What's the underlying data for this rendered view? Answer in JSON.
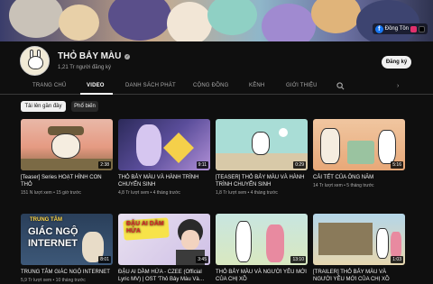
{
  "banner": {
    "link_label": "Đồng Tồn",
    "link_icon": "facebook-icon"
  },
  "channel": {
    "name": "THỎ BẢY MÀU",
    "verified_mark": "✓",
    "subscribers": "1,21 Tr người đăng ký",
    "subscribe_label": "Đăng ký"
  },
  "tabs": [
    {
      "label": "TRANG CHỦ"
    },
    {
      "label": "VIDEO"
    },
    {
      "label": "DANH SÁCH PHÁT"
    },
    {
      "label": "CỘNG ĐỒNG"
    },
    {
      "label": "KÊNH"
    },
    {
      "label": "GIỚI THIỆU"
    }
  ],
  "active_tab": "VIDEO",
  "filters": [
    {
      "label": "Tải lên gần đây",
      "selected": true
    },
    {
      "label": "Phổ biến",
      "selected": false
    }
  ],
  "videos": [
    {
      "title": "[Teaser] Series HOẠT HÌNH CON THỎ",
      "views": "151 N lượt xem",
      "age": "15 giờ trước",
      "duration": "2:38"
    },
    {
      "title": "THỎ BẢY MÀU VÀ HÀNH TRÌNH CHUYỂN SINH",
      "views": "4,8 Tr lượt xem",
      "age": "4 tháng trước",
      "duration": "9:11"
    },
    {
      "title": "[TEASER] THỎ BẢY MÀU VÀ HÀNH TRÌNH CHUYỂN SINH",
      "views": "1,8 Tr lượt xem",
      "age": "4 tháng trước",
      "duration": "0:29"
    },
    {
      "title": "CẢI TẾT CỦA ÔNG NĂM",
      "views": "14 Tr lượt xem",
      "age": "5 tháng trước",
      "duration": "5:16"
    },
    {
      "title": "TRUNG TÂM GIÁC NGỘ INTERNET",
      "views": "5,9 Tr lượt xem",
      "age": "10 tháng trước",
      "duration": "8:01",
      "thumb_text_top": "TRUNG TÂM",
      "thumb_text_big": "GIÁC NGỘ",
      "thumb_text_big2": "INTERNET"
    },
    {
      "title": "ĐẬU AI DẦM HỨA - CZEE (Official Lyric MV) | OST 'Thỏ Bảy Màu Và…",
      "views": "",
      "age": "",
      "duration": "3:45",
      "thumb_text_big": "ĐẬU AI DẦM HỨA"
    },
    {
      "title": "THỎ BẢY MÀU VÀ NGƯỜI YÊU MỚI CỦA CHỊ XỒ",
      "views": "",
      "age": "",
      "duration": "13:10"
    },
    {
      "title": "[TRAILER] THỎ BẢY MÀU VÀ NGƯỜI YÊU MỚI CỦA CHỊ XỒ",
      "views": "",
      "age": "",
      "duration": "1:03"
    }
  ]
}
